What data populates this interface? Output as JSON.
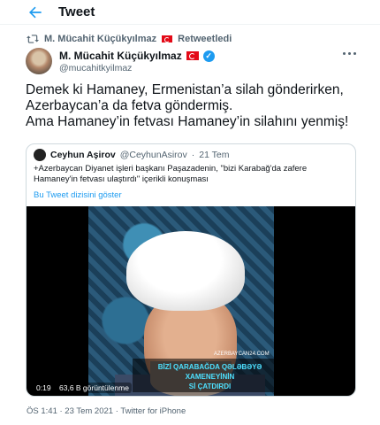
{
  "header": {
    "title": "Tweet",
    "back_icon": "back-arrow-icon"
  },
  "retweet": {
    "user": "M. Mücahit Küçükyılmaz",
    "label": "Retweetledi"
  },
  "author": {
    "name": "M. Mücahit Küçükyılmaz",
    "handle": "@mucahitkyilmaz"
  },
  "tweet": {
    "text": "Demek ki Hamaney, Ermenistan’a silah gönderirken,\nAzerbaycan’a da fetva göndermiş.\nAma Hamaney’in fetvası Hamaney’in silahını yenmiş!"
  },
  "quote": {
    "name": "Ceyhun Aşirov",
    "handle": "@CeyhunAsirov",
    "time": "21 Tem",
    "text": "+Azerbaycan Diyanet işleri başkanı Paşazadenin, \"bizi Karabağ'da zafere\nHamaney'in fetvası ulaştırdı\" içerikli konuşması",
    "link": "Bu Tweet dizisini göster",
    "video": {
      "watermark": "AZERBAYCAN24.COM",
      "caption": "BİZİ QARABAĞDA QƏLƏBƏYƏ XAMENEYİNİN\nSİ ÇATDIRDI",
      "duration": "0:19",
      "views": "63,6 B görüntülenme"
    }
  },
  "footer": {
    "meta": "ÖS 1:41 · 23 Tem 2021 · Twitter for iPhone"
  },
  "colors": {
    "accent": "#1d9bf0",
    "text": "#0f1419",
    "muted": "#536471"
  }
}
